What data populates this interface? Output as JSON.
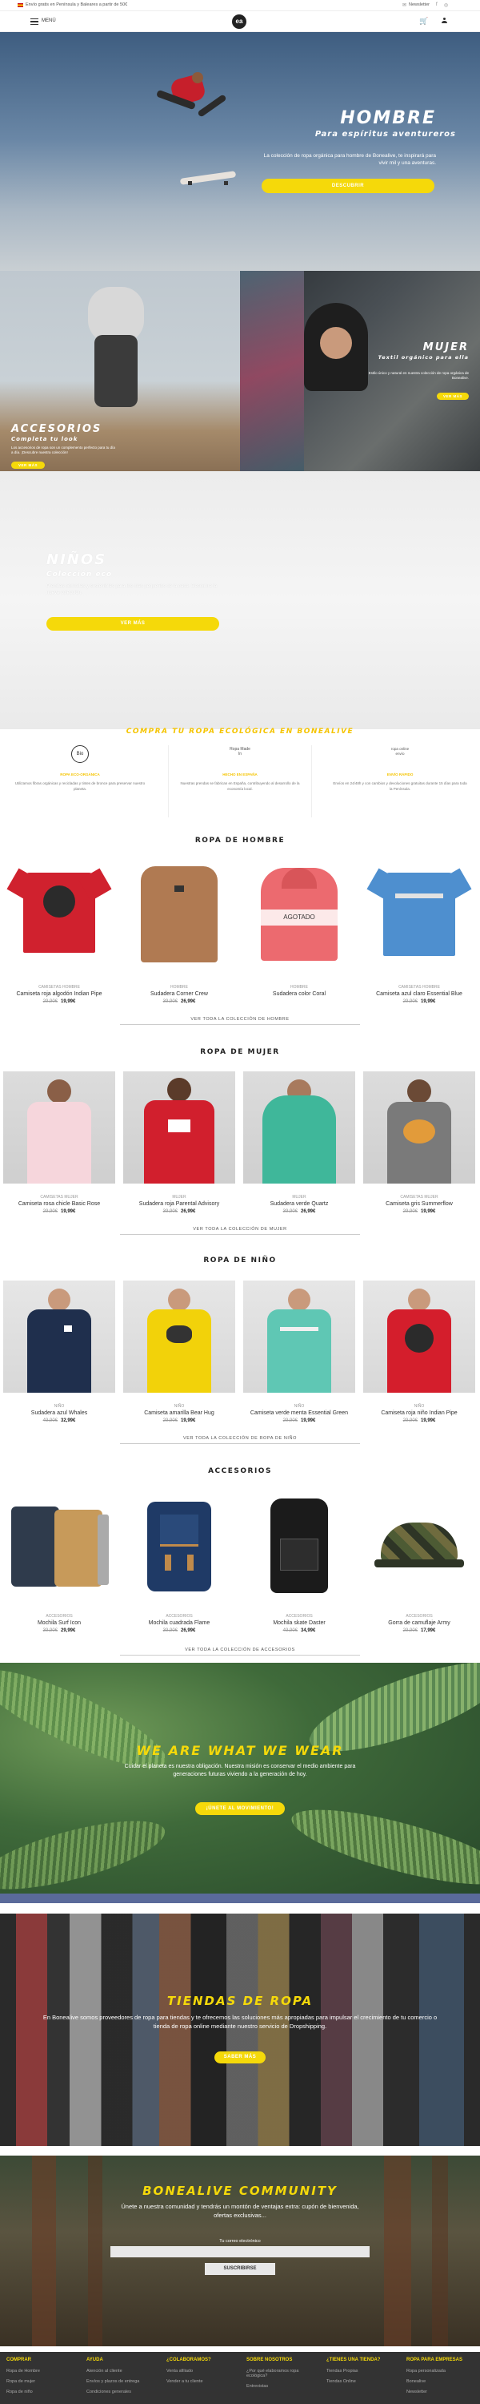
{
  "topbar": {
    "shipping_text": "Envío gratis en Península y Baleares a partir de 50€",
    "newsletter": "Newsletter"
  },
  "header": {
    "menu_label": "MENÚ",
    "logo": "ea"
  },
  "hero_hombre": {
    "title": "HOMBRE",
    "subtitle": "Para espíritus aventureros",
    "text": "La colección de ropa orgánica para hombre de Bonealive, te inspirará para vivir mil y una aventuras.",
    "button": "DESCUBRIR"
  },
  "banner_accesorios": {
    "title": "ACCESORIOS",
    "subtitle": "Completa tu look",
    "text": "Los accesorios de ropa son un complemento perfecto para tu día a día. ¡Descubre nuestra colección!",
    "button": "VER MÁS"
  },
  "banner_mujer": {
    "title": "MUJER",
    "subtitle": "Textil orgánico para ella",
    "text": "Estilo único y natural en nuestra colección de ropa orgánica de Bonealive.",
    "button": "VER MÁS"
  },
  "banner_ninos": {
    "title": "NIÑOS",
    "subtitle": "Colección eco",
    "text": "Prendas cómodas y sostenibles para los más pequeños de la casa. Descubre la nueva colección.",
    "button": "VER MÁS"
  },
  "eco": {
    "title": "COMPRA TU ROPA ECOLÓGICA EN BONEALIVE",
    "features": [
      {
        "icon_text": "Bio",
        "heading": "ROPA ECO-ORGÁNICA",
        "text": "Utilizamos fibras orgánicas y recicladas y tintes de bronce para preservar nuestro planeta."
      },
      {
        "icon_text": "Ropa Made In",
        "heading": "HECHO EN ESPAÑA",
        "text": "Nuestras prendas se fabrican en España, contribuyendo al desarrollo de la economía local."
      },
      {
        "icon_text": "ropa online envío",
        "heading": "ENVÍO RÁPIDO",
        "text": "Envíos en 24/48h y con cambios y devoluciones gratuitas durante 15 días para toda la Península."
      }
    ]
  },
  "sections": {
    "hombre": {
      "title": "ROPA DE HOMBRE",
      "see_all": "VER TODA LA COLECCIÓN DE HOMBRE",
      "products": [
        {
          "brand": "CAMISETAS HOMBRE",
          "name": "Camiseta roja algodón Indian Pipe",
          "old": "29,90€",
          "new": "19,99€"
        },
        {
          "brand": "HOMBRE",
          "name": "Sudadera Corner Crew",
          "old": "39,90€",
          "new": "26,99€"
        },
        {
          "brand": "HOMBRE",
          "name": "Sudadera color Coral",
          "old": "",
          "new": "",
          "badge": "AGOTADO"
        },
        {
          "brand": "CAMISETAS HOMBRE",
          "name": "Camiseta azul claro Essential Blue",
          "old": "29,90€",
          "new": "19,99€"
        }
      ]
    },
    "mujer": {
      "title": "ROPA DE MUJER",
      "see_all": "VER TODA LA COLECCIÓN DE MUJER",
      "products": [
        {
          "brand": "CAMISETAS MUJER",
          "name": "Camiseta rosa chicle Basic Rose",
          "old": "29,90€",
          "new": "19,99€"
        },
        {
          "brand": "MUJER",
          "name": "Sudadera roja Parental Advisory",
          "old": "39,90€",
          "new": "26,99€"
        },
        {
          "brand": "MUJER",
          "name": "Sudadera verde Quartz",
          "old": "39,90€",
          "new": "26,99€"
        },
        {
          "brand": "CAMISETAS MUJER",
          "name": "Camiseta gris Summerflow",
          "old": "29,90€",
          "new": "19,99€"
        }
      ]
    },
    "nino": {
      "title": "ROPA DE NIÑO",
      "see_all": "VER TODA LA COLECCIÓN DE ROPA DE NIÑO",
      "products": [
        {
          "brand": "NIÑO",
          "name": "Sudadera azul Whales",
          "old": "49,90€",
          "new": "32,99€"
        },
        {
          "brand": "NIÑO",
          "name": "Camiseta amarilla Bear Hug",
          "old": "29,90€",
          "new": "19,99€"
        },
        {
          "brand": "NIÑO",
          "name": "Camiseta verde menta Essential Green",
          "old": "29,90€",
          "new": "19,99€"
        },
        {
          "brand": "NIÑO",
          "name": "Camiseta roja niño Indian Pipe",
          "old": "29,90€",
          "new": "19,99€"
        }
      ]
    },
    "accesorios": {
      "title": "ACCESORIOS",
      "see_all": "VER TODA LA COLECCIÓN DE ACCESORIOS",
      "products": [
        {
          "brand": "ACCESORIOS",
          "name": "Mochila Surf Icon",
          "old": "39,90€",
          "new": "29,99€"
        },
        {
          "brand": "ACCESORIOS",
          "name": "Mochila cuadrada Flame",
          "old": "39,90€",
          "new": "26,99€"
        },
        {
          "brand": "ACCESORIOS",
          "name": "Mochila skate Daster",
          "old": "49,90€",
          "new": "34,99€"
        },
        {
          "brand": "ACCESORIOS",
          "name": "Gorra de camuflaje Army",
          "old": "29,90€",
          "new": "17,99€"
        }
      ]
    }
  },
  "wawww": {
    "title": "WE ARE WHAT WE WEAR",
    "text": "Cuidar el planeta es nuestra obligación. Nuestra misión es conservar el medio ambiente para generaciones futuras viviendo a la generación de hoy.",
    "button": "¡ÚNETE AL MOVIMIENTO!"
  },
  "tiendas": {
    "title": "TIENDAS DE ROPA",
    "text": "En Bonealive somos proveedores de ropa para tiendas y te ofrecemos las soluciones más apropiadas para impulsar el crecimiento de tu comercio o tienda de ropa online mediante nuestro servicio de Dropshipping.",
    "button": "SABER MÁS"
  },
  "community": {
    "title": "BONEALIVE COMMUNITY",
    "text": "Únete a nuestra comunidad y tendrás un montón de ventajas extra: cupón de bienvenida, ofertas exclusivas...",
    "email_label": "Tu correo electrónico",
    "button": "SUSCRIBIRSE"
  },
  "footer": {
    "columns": [
      {
        "heading": "COMPRAR",
        "links": [
          "Ropa de Hombre",
          "Ropa de mujer",
          "Ropa de niño"
        ]
      },
      {
        "heading": "AYUDA",
        "links": [
          "Atención al cliente",
          "Envíos y plazos de entrega",
          "Condiciones generales"
        ]
      },
      {
        "heading": "¿COLABORAMOS?",
        "links": [
          "Venta afiliado",
          "Vender a tu cliente"
        ]
      },
      {
        "heading": "SOBRE NOSOTROS",
        "links": [
          "¿Por qué elaboramos ropa ecológica?",
          "Entrevistas"
        ]
      },
      {
        "heading": "¿TIENES UNA TIENDA?",
        "links": [
          "Tiendas Propias",
          "Tiendas Online"
        ]
      },
      {
        "heading": "ROPA PARA EMPRESAS",
        "links": [
          "Ropa personalizada",
          "Bonealive",
          "Newsletter"
        ]
      }
    ]
  },
  "colors": {
    "accent": "#f5d90a",
    "footer_bg": "#333333"
  }
}
